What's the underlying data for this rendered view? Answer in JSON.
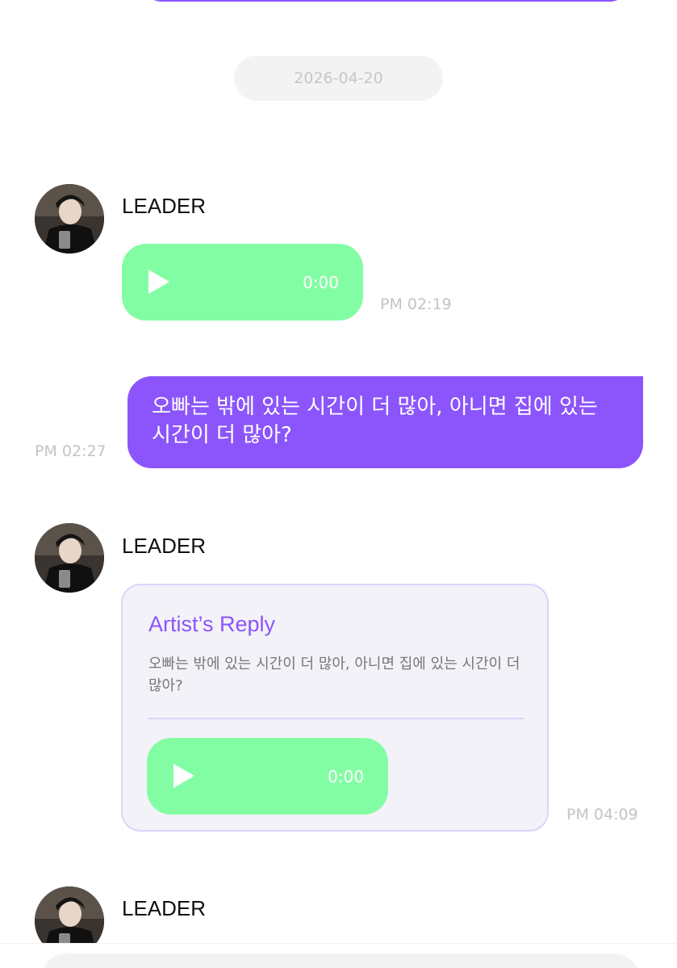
{
  "date_divider": "2026-04-20",
  "messages": [
    {
      "sender": "LEADER",
      "voice_duration": "0:00",
      "time": "PM 02:19"
    },
    {
      "text": "오빠는 밖에 있는 시간이 더 많아, 아니면 집에 있는 시간이 더 많아?",
      "time": "PM 02:27"
    },
    {
      "sender": "LEADER",
      "reply_title": "Artist’s Reply",
      "quote": "오빠는 밖에 있는 시간이 더 많아, 아니면 집에 있는 시간이 더 많아?",
      "voice_duration": "0:00",
      "time": "PM 04:09"
    },
    {
      "sender": "LEADER"
    }
  ],
  "icons": {
    "play": "play-icon",
    "avatar": "leader-avatar"
  },
  "colors": {
    "accent": "#8b55fb",
    "voice_bubble": "#83fda4",
    "reply_card_bg": "#f3f2f9",
    "reply_card_border": "#ddd3fb",
    "timestamp": "#c4c4c4"
  }
}
